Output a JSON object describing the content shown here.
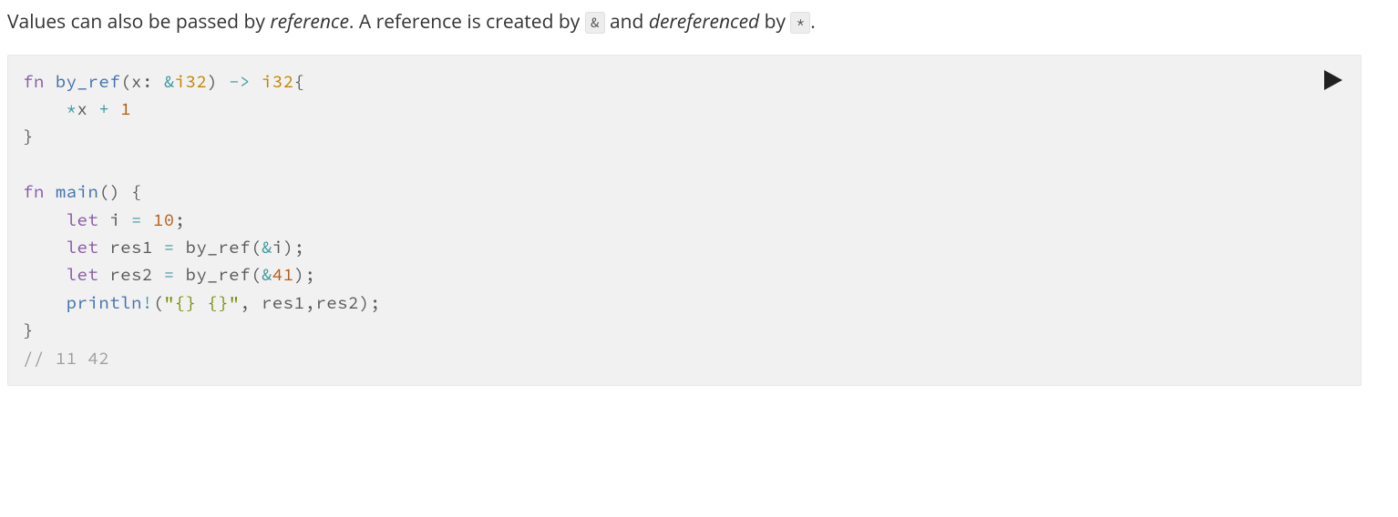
{
  "prose": {
    "p1a": "Values can also be passed by ",
    "p1_em1": "reference",
    "p1b": ". A reference is created by ",
    "p1_code1": "&",
    "p1c": " and ",
    "p1_em2": "dereferenced",
    "p1d": " by ",
    "p1_code2": "*",
    "p1e": "."
  },
  "code": {
    "fn_kw": "fn",
    "by_ref": "by_ref",
    "lparen": "(",
    "x_ident": "x",
    "colon": ":",
    "sp": " ",
    "amp": "&",
    "i32": "i32",
    "rparen": ")",
    "arrow": "->",
    "lbrace": "{",
    "rbrace": "}",
    "star": "*",
    "x2": "x",
    "plus": "+",
    "one": "1",
    "main": "main",
    "let_kw": "let",
    "i_ident": "i",
    "eq": "=",
    "ten": "10",
    "semi": ";",
    "res1": "res1",
    "res2": "res2",
    "fortyone": "41",
    "println": "println",
    "bang": "!",
    "fmt_str": "\"{} {}\"",
    "comma": ",",
    "out_comment": "// 11 42"
  }
}
